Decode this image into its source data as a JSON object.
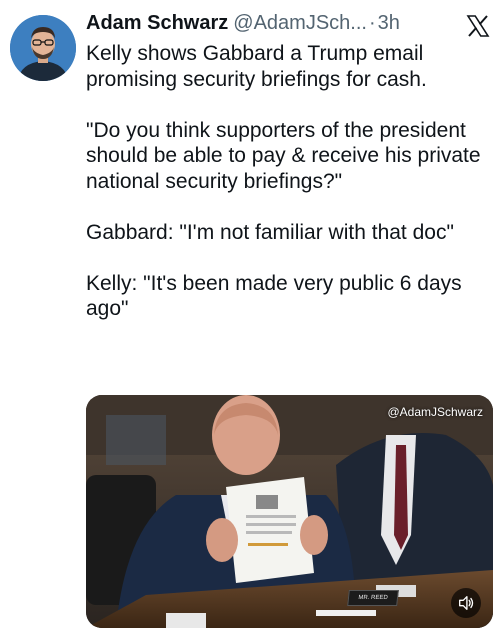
{
  "author": {
    "name": "Adam Schwarz",
    "handle": "@AdamJSch...",
    "separator": "·",
    "time": "3h"
  },
  "icons": {
    "logo": "x-logo-icon",
    "avatar": "profile-photo",
    "sound": "speaker-icon"
  },
  "tweet": {
    "text": "Kelly shows Gabbard a Trump email promising security briefings for cash.\n\n\"Do you think supporters of the president should be able to pay & receive his private national security briefings?\"\n\nGabbard: \"I'm not familiar with that doc\"\n\nKelly: \"It's been made very public 6 days ago\""
  },
  "media": {
    "watermark": "@AdamJSchwarz",
    "nameplate": "MR. REED"
  },
  "colors": {
    "text": "#0f1419",
    "secondary": "#536471",
    "background": "#ffffff"
  }
}
